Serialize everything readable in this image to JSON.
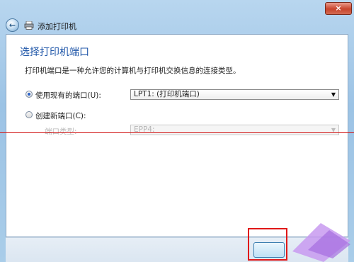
{
  "window": {
    "close_label": "×",
    "title": "添加打印机"
  },
  "page": {
    "heading": "选择打印机端口",
    "description": "打印机端口是一种允许您的计算机与打印机交换信息的连接类型。"
  },
  "options": {
    "existing_port": {
      "label": "使用现有的端口(U):",
      "selected": true,
      "value": "LPT1: (打印机端口)"
    },
    "new_port": {
      "label": "创建新端口(C):",
      "selected": false,
      "type_label": "端口类型:",
      "type_value": "EPP4:"
    }
  },
  "icons": {
    "back": "back-arrow-icon",
    "printer": "printer-icon",
    "dropdown": "chevron-down-icon"
  },
  "colors": {
    "heading": "#1f56a8",
    "annotation": "#e01818"
  }
}
